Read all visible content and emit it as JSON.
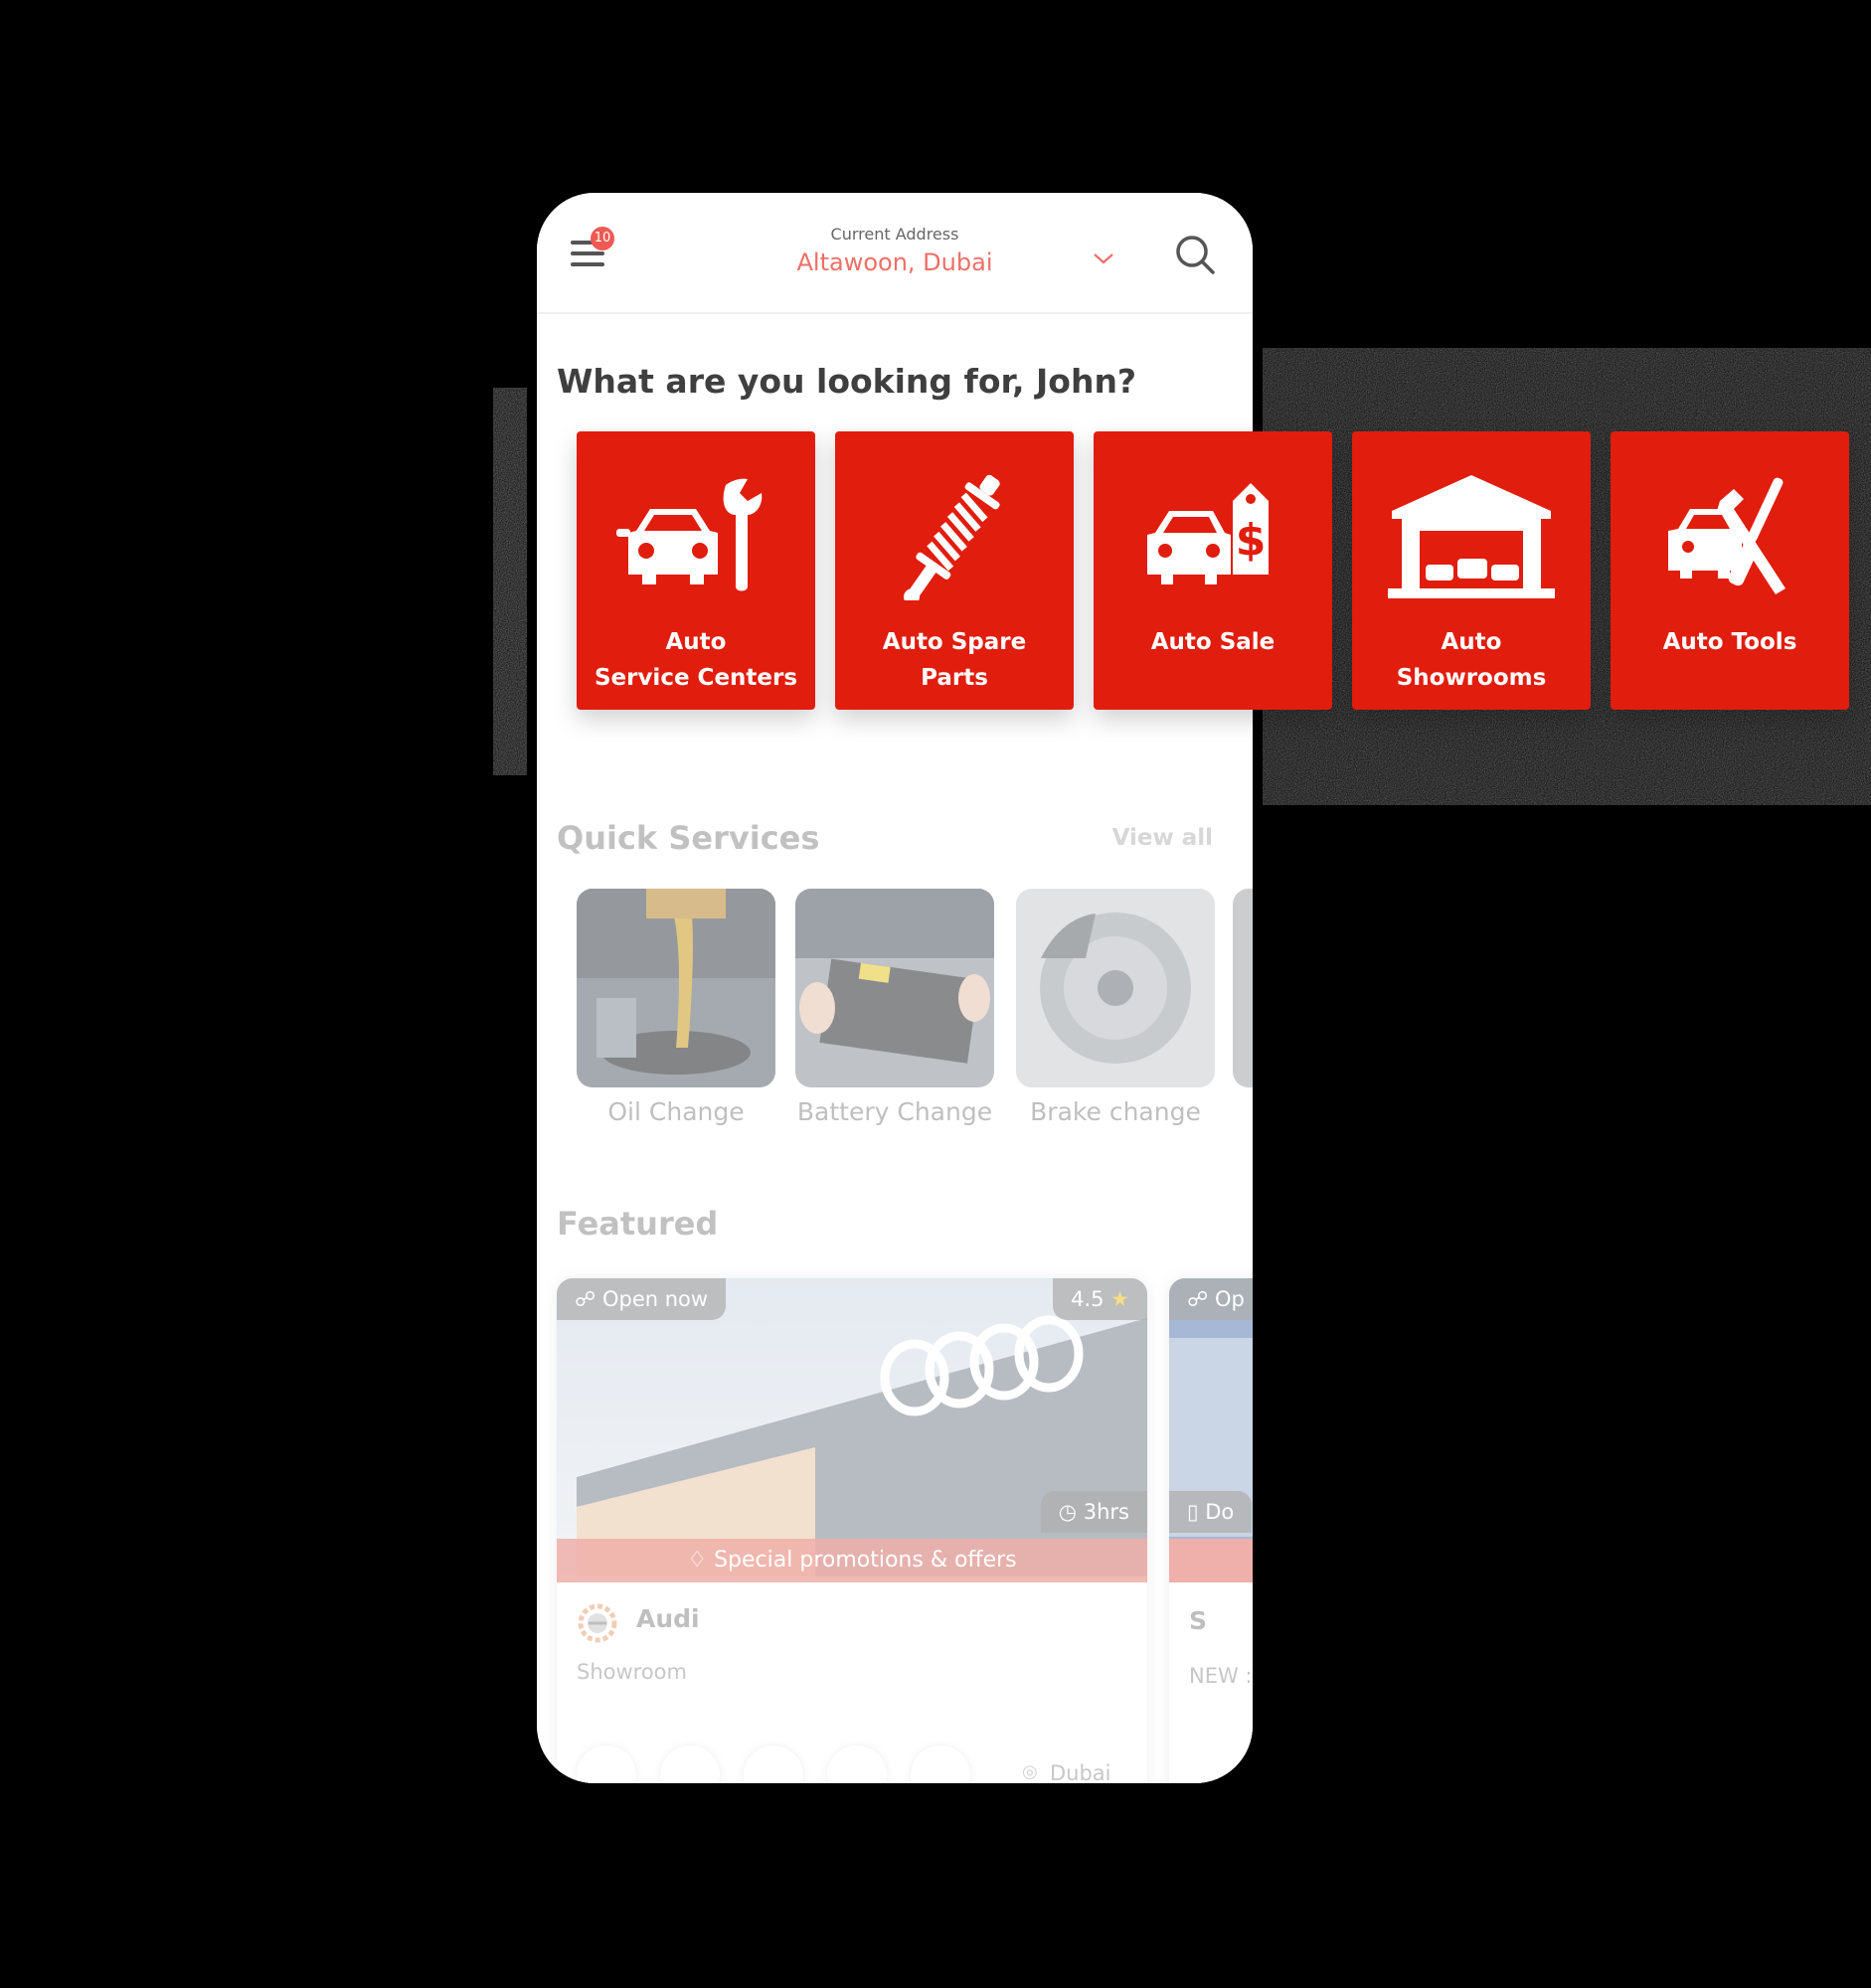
{
  "header": {
    "menu_badge": "10",
    "address_label": "Current Address",
    "address_value": "Altawoon, Dubai"
  },
  "greeting": "What are you looking for, John?",
  "categories": [
    {
      "line1": "Auto",
      "line2": "Service Centers",
      "icon": "car-wrench-icon"
    },
    {
      "line1": "Auto Spare",
      "line2": "Parts",
      "icon": "shock-absorber-icon"
    },
    {
      "line1": "Auto Sale",
      "line2": "",
      "icon": "car-price-tag-icon"
    },
    {
      "line1": "Auto",
      "line2": "Showrooms",
      "icon": "showroom-garage-icon"
    },
    {
      "line1": "Auto Tools",
      "line2": "",
      "icon": "car-tools-icon"
    }
  ],
  "quick_services": {
    "title": "Quick Services",
    "view_all": "View all",
    "items": [
      {
        "label": "Oil Change"
      },
      {
        "label": "Battery Change"
      },
      {
        "label": "Brake change"
      }
    ]
  },
  "featured": {
    "title": "Featured",
    "cards": [
      {
        "status": "Open now",
        "rating": "4.5",
        "duration": "3hrs",
        "promo": "Special promotions & offers",
        "name": "Audi",
        "type": "Showroom",
        "location": "Dubai"
      },
      {
        "status": "Op",
        "duration": "Do",
        "name": "S",
        "type": "NEW : C"
      }
    ]
  },
  "colors": {
    "brand_red": "#e11d0e",
    "accent_coral": "#ee6f66"
  }
}
